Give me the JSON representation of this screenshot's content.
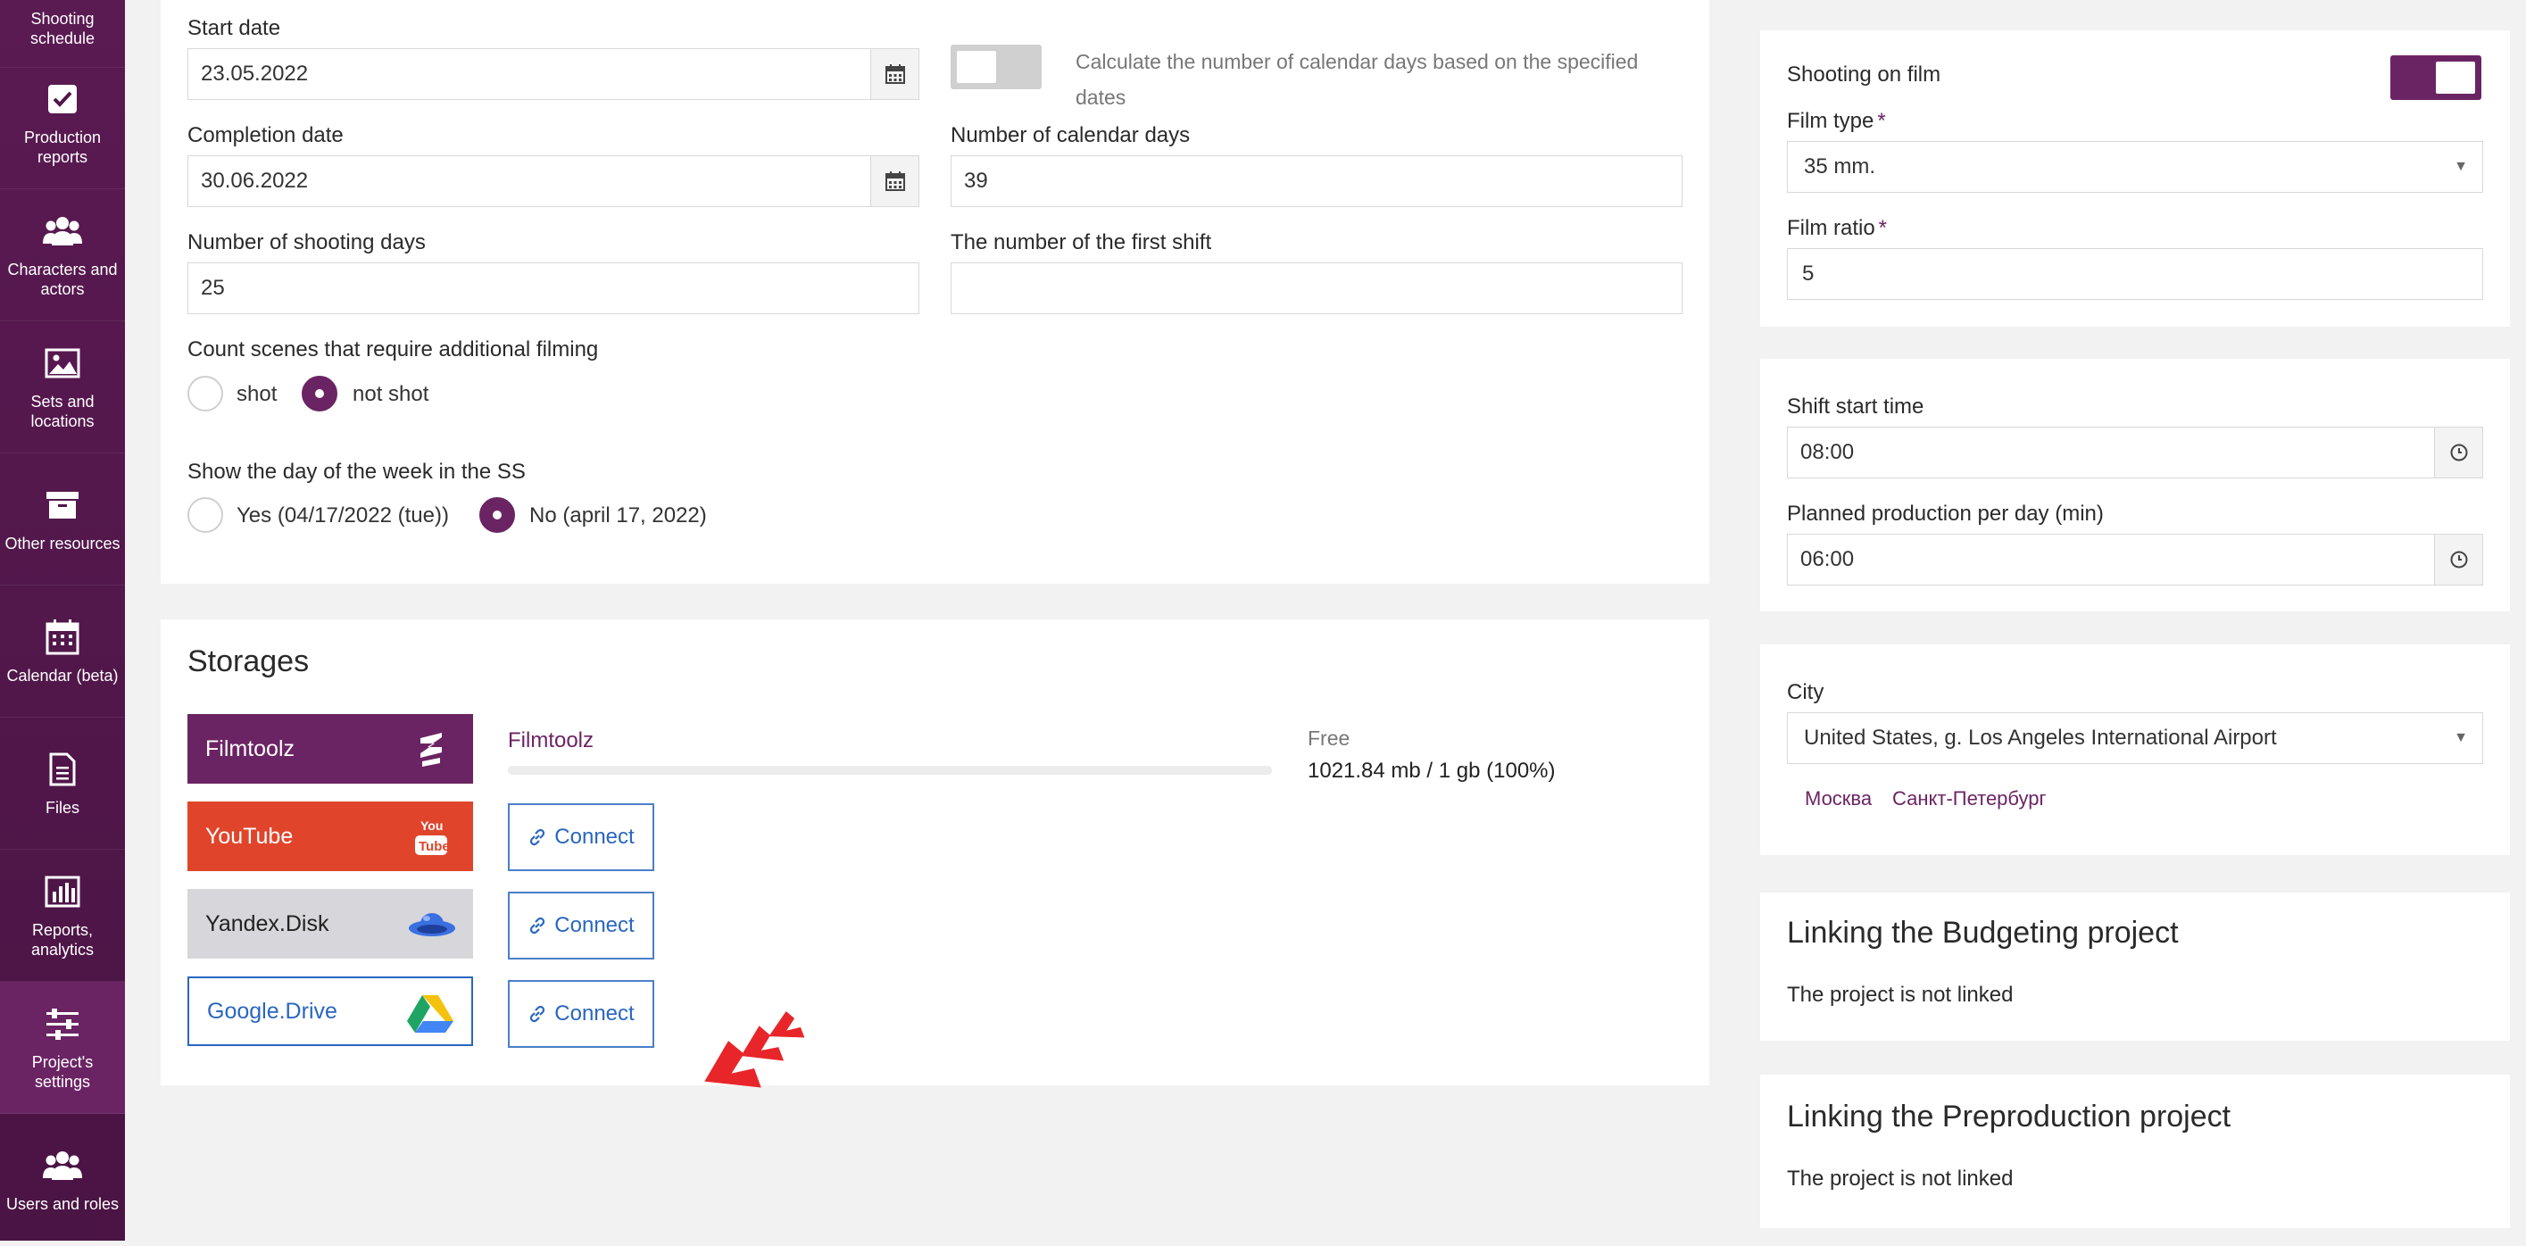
{
  "sidebar": {
    "items": [
      {
        "label": "Shooting schedule",
        "icon": "calendar-list-icon"
      },
      {
        "label": "Production reports",
        "icon": "checkbox-icon"
      },
      {
        "label": "Characters and actors",
        "icon": "group-icon"
      },
      {
        "label": "Sets and locations",
        "icon": "image-icon"
      },
      {
        "label": "Other resources",
        "icon": "archive-box-icon"
      },
      {
        "label": "Calendar (beta)",
        "icon": "calendar-icon"
      },
      {
        "label": "Files",
        "icon": "file-icon"
      },
      {
        "label": "Reports, analytics",
        "icon": "bar-chart-icon"
      },
      {
        "label": "Project's settings",
        "icon": "sliders-icon"
      },
      {
        "label": "Users and roles",
        "icon": "users-icon"
      }
    ]
  },
  "dates": {
    "start_label": "Start date",
    "start_value": "23.05.2022",
    "calc_text_1": "Calculate the number of calendar days based on the specified",
    "calc_text_2": "dates",
    "completion_label": "Completion date",
    "completion_value": "30.06.2022",
    "calendar_days_label": "Number of calendar days",
    "calendar_days_value": "39",
    "shooting_days_label": "Number of shooting days",
    "shooting_days_value": "25",
    "first_shift_label": "The number of the first shift",
    "first_shift_value": ""
  },
  "count_scenes": {
    "label": "Count scenes that require additional filming",
    "option_shot": "shot",
    "option_not_shot": "not shot",
    "selected": "not shot"
  },
  "weekday": {
    "label": "Show the day of the week in the SS",
    "option_yes": "Yes (04/17/2022 (tue))",
    "option_no": "No (april 17, 2022)",
    "selected": "No (april 17, 2022)"
  },
  "storages": {
    "title": "Storages",
    "filmtoolz_btn": "Filmtoolz",
    "youtube_btn": "YouTube",
    "yandex_btn": "Yandex.Disk",
    "gdrive_btn": "Google.Drive",
    "connect_label": "Connect",
    "filmtoolz_link": "Filmtoolz",
    "free_label": "Free",
    "usage": "1021.84 mb / 1 gb (100%)",
    "usage_percent": 100
  },
  "film": {
    "shooting_on_film_label": "Shooting on film",
    "shooting_on_film": true,
    "type_label": "Film type",
    "type_value": "35 mm.",
    "ratio_label": "Film ratio",
    "ratio_value": "5",
    "required_mark": "*"
  },
  "shift": {
    "start_label": "Shift start time",
    "start_value": "08:00",
    "planned_label": "Planned production per day (min)",
    "planned_value": "06:00"
  },
  "city": {
    "label": "City",
    "value": "United States, g. Los Angeles International Airport",
    "quick_1": "Москва",
    "quick_2": "Санкт-Петербург"
  },
  "budgeting": {
    "title": "Linking the Budgeting project",
    "status": "The project is not linked"
  },
  "preproduction": {
    "title": "Linking the Preproduction project",
    "status": "The project is not linked"
  },
  "colors": {
    "brand": "#6b2463",
    "sidebar": "#4f1749",
    "youtube": "#e0452b",
    "link_blue": "#2a66c0"
  }
}
